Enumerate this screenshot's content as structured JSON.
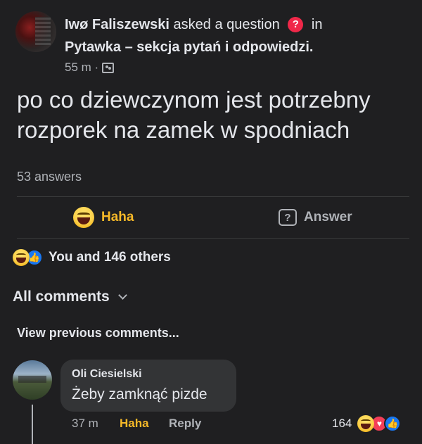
{
  "post": {
    "author": "Iwø Faliszewski",
    "action_text": "asked a question",
    "question_badge": "?",
    "in_text": "in",
    "group": "Pytawka – sekcja pytań i odpowiedzi.",
    "time": "55 m ·",
    "question": "po co dziewczynom jest potrzebny rozporek na zamek w spodniach",
    "answers_count": "53 answers"
  },
  "actions": {
    "haha_label": "Haha",
    "answer_label": "Answer",
    "answer_icon_glyph": "?"
  },
  "reactions": {
    "summary": "You and 146 others",
    "like_glyph": "👍"
  },
  "comments_section": {
    "filter_label": "All comments",
    "view_previous": "View previous comments..."
  },
  "comment": {
    "author": "Oli Ciesielski",
    "text": "Żeby zamknąć pizde",
    "time": "37 m",
    "haha_label": "Haha",
    "reply_label": "Reply",
    "reaction_count": "164",
    "like_glyph": "👍",
    "heart_glyph": "♥"
  },
  "colors": {
    "background": "#1f1f21",
    "haha": "#f7b928",
    "like": "#1877f2",
    "love": "#f33e58",
    "question_badge": "#f02849"
  },
  "icons": {
    "haha_reaction": "haha-face-icon",
    "like_reaction": "like-icon",
    "love_reaction": "heart-icon",
    "answer": "question-bubble-icon",
    "group": "group-icon",
    "dropdown": "chevron-down-icon"
  }
}
